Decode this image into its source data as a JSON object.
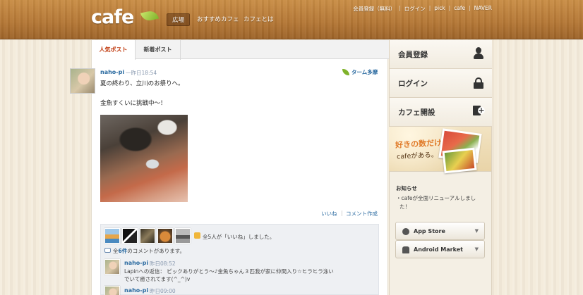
{
  "header": {
    "logo": "cafe",
    "gnav": [
      "広場",
      "おすすめカフェ",
      "カフェとは"
    ],
    "util": [
      "会員登録（無料）",
      "ログイン",
      "pick",
      "cafe",
      "NAVER"
    ]
  },
  "tabs": [
    "人気ポスト",
    "新着ポスト"
  ],
  "post": {
    "author": "naho-pi",
    "time": "一昨日18:54",
    "theme": "ターム多摩",
    "line1": "夏の終わり、立川のお祭りへ。",
    "line2": "金魚すくいに挑戦中〜！",
    "like_link": "いいね",
    "comment_link": "コメント作成",
    "likes_text": "全5人が「いいね」しました。",
    "comment_count_prefix": "全",
    "comment_count": "6件",
    "comment_count_suffix": "のコメントがあります。"
  },
  "comments": [
    {
      "author": "naho-pi",
      "time": "昨日08:52",
      "line1": "Lapinへの返信： ピックありがとう〜♪金魚ちゃん３匹我が家に仲間入り☆ヒラヒラ泳い",
      "line2": "でいて癒されてます(^_^)v"
    },
    {
      "author": "naho-pi",
      "time": "昨日09:00"
    }
  ],
  "sidebar": {
    "buttons": [
      "会員登録",
      "ログイン",
      "カフェ開設"
    ],
    "banner_line1": "好きの数だけ",
    "banner_line2": "cafeがある。",
    "notice_title": "お知らせ",
    "notice_line1": "・cafeが全面リニューアルしまし",
    "notice_line2": "た！",
    "stores": [
      "App Store",
      "Android Market"
    ]
  },
  "colors": {
    "header_wood": "#b57836",
    "active_tab_text": "#c03b10",
    "link_blue": "#2a6aa0",
    "leaf_green": "#7fb22a"
  }
}
